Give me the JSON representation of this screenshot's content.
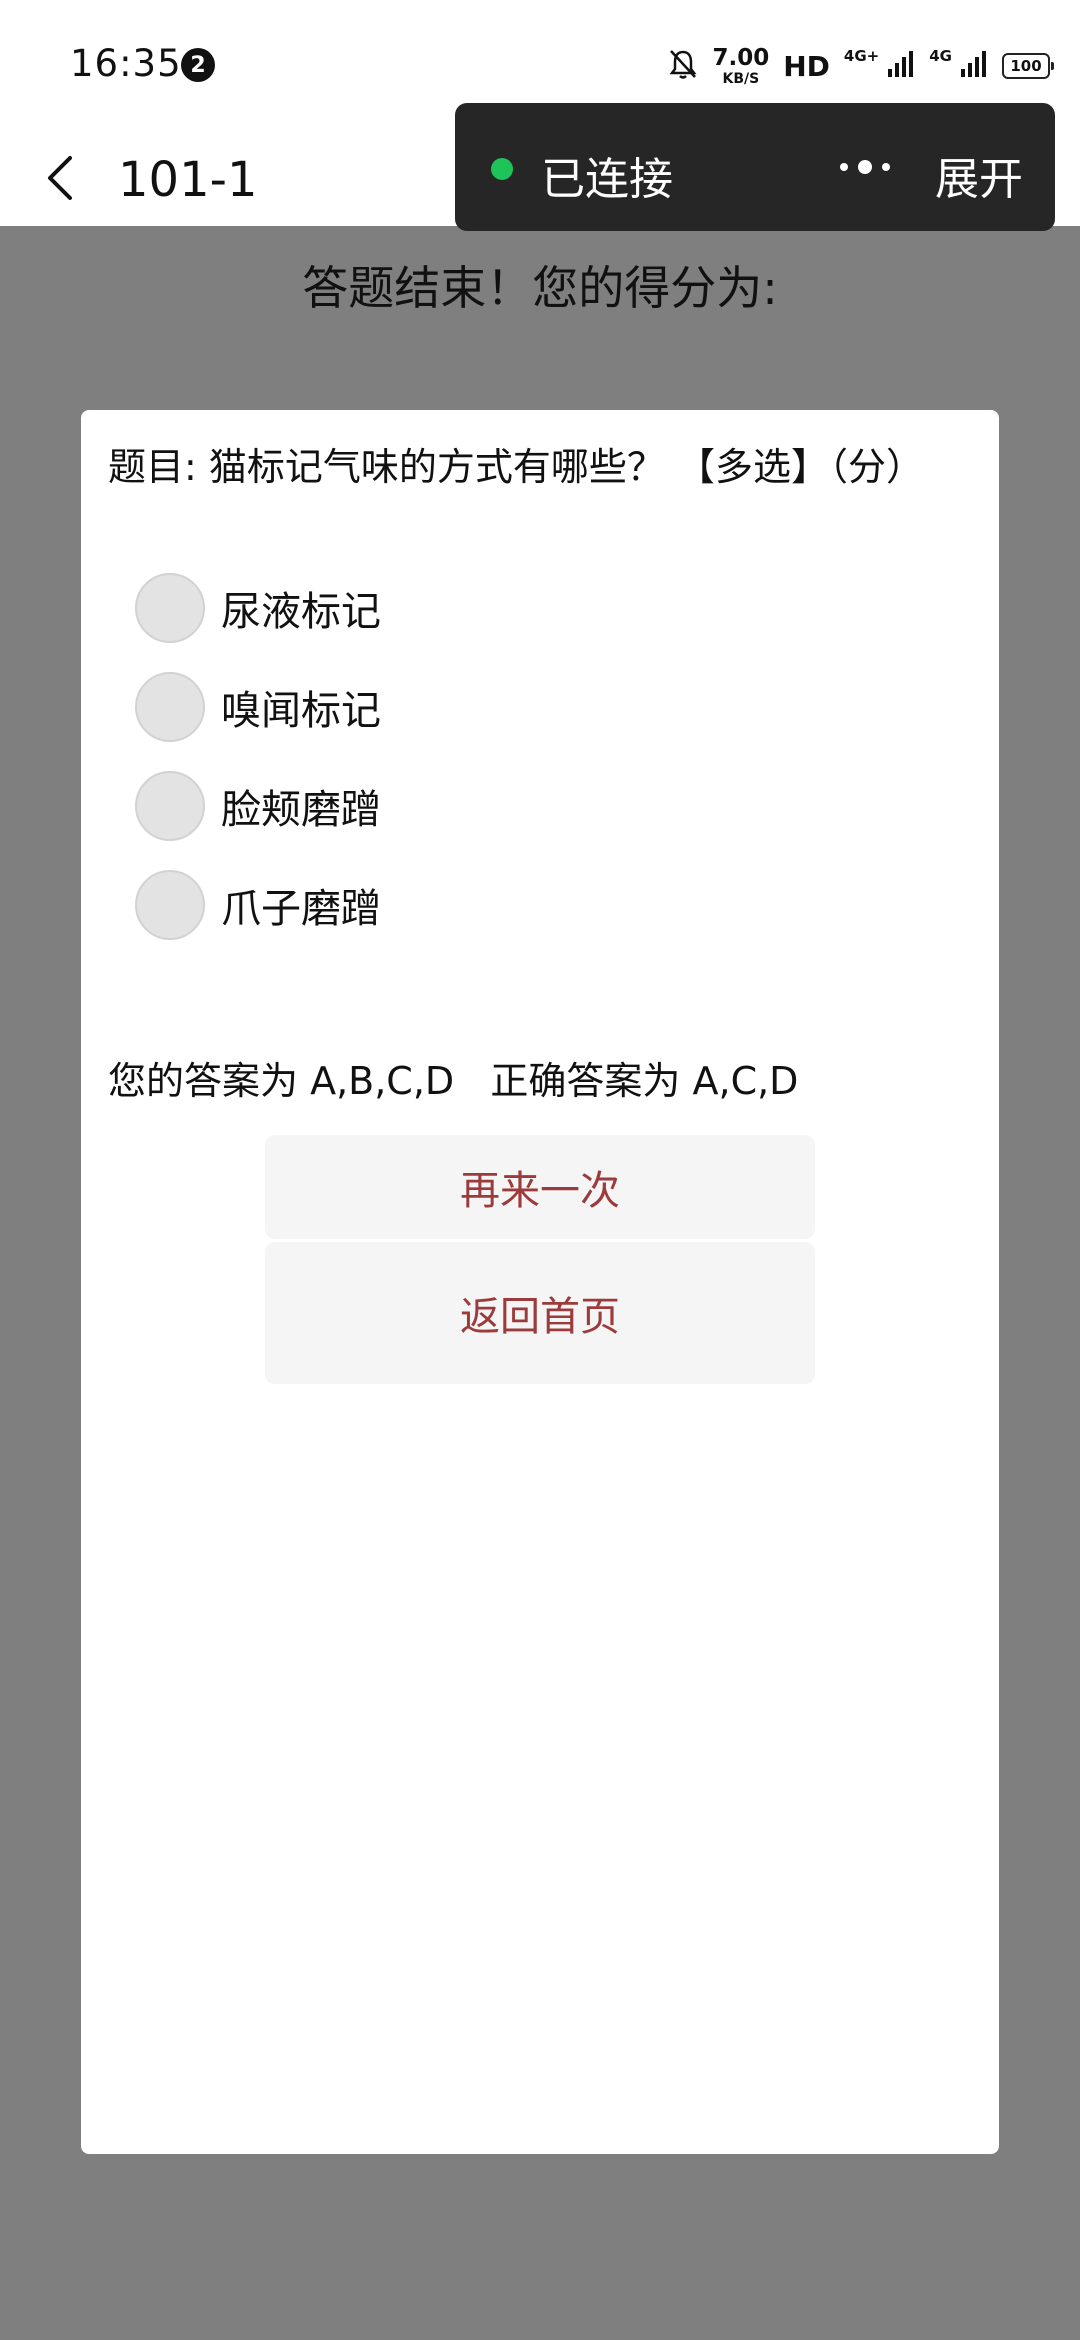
{
  "status_bar": {
    "time": "16:35",
    "notification_count": "2",
    "speed_value": "7.00",
    "speed_unit": "KB/S",
    "hd_label": "HD",
    "network_1": "4G+",
    "network_2": "4G",
    "battery": "100"
  },
  "nav": {
    "title": "101-1"
  },
  "connection_panel": {
    "status_text": "已连接",
    "expand_label": "展开",
    "dot_color": "#1ec35a"
  },
  "result": {
    "heading": "答题结束！您的得分为:"
  },
  "question": {
    "text": "题目: 猫标记气味的方式有哪些？ 【多选】（分）",
    "options": [
      {
        "label": "尿液标记"
      },
      {
        "label": "嗅闻标记"
      },
      {
        "label": "脸颊磨蹭"
      },
      {
        "label": "爪子磨蹭"
      }
    ],
    "answer_line": "您的答案为 A,B,C,D   正确答案为 A,C,D"
  },
  "buttons": {
    "retry_label": "再来一次",
    "home_label": "返回首页"
  },
  "colors": {
    "overlay": "#7f7f7f",
    "button_text": "#9b3b3b"
  }
}
